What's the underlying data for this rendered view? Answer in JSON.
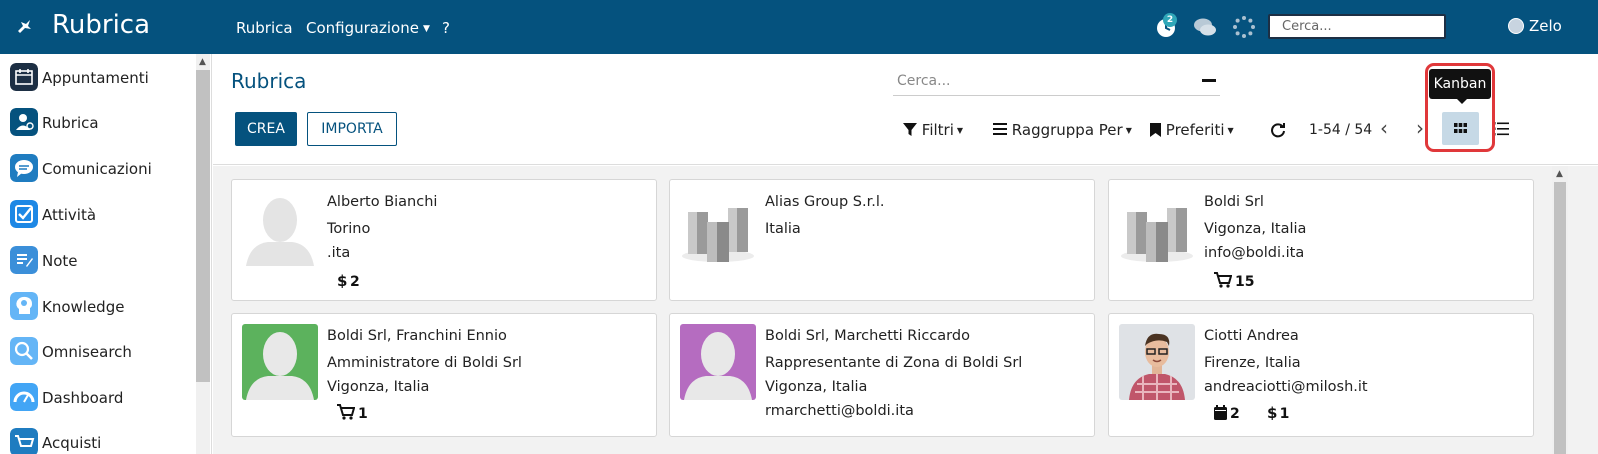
{
  "topbar": {
    "app_title": "Rubrica",
    "menu": [
      {
        "label": "Rubrica"
      },
      {
        "label": "Configurazione"
      },
      {
        "label": "?"
      }
    ],
    "activity_badge": "2",
    "search_placeholder": "Cerca...",
    "user_name": "Zelo",
    "color": "#05527e"
  },
  "sidebar": {
    "items": [
      {
        "label": "Appuntamenti",
        "icon": "calendar-icon",
        "color": "#1d2f44"
      },
      {
        "label": "Rubrica",
        "icon": "contacts-icon",
        "color": "#05527e"
      },
      {
        "label": "Comunicazioni",
        "icon": "chat-icon",
        "color": "#1f7cc0"
      },
      {
        "label": "Attività",
        "icon": "checkbox-icon",
        "color": "#1e88e5"
      },
      {
        "label": "Note",
        "icon": "note-icon",
        "color": "#3b8fd9"
      },
      {
        "label": "Knowledge",
        "icon": "brain-icon",
        "color": "#64b5f6"
      },
      {
        "label": "Omnisearch",
        "icon": "search-icon",
        "color": "#64b5f6"
      },
      {
        "label": "Dashboard",
        "icon": "dashboard-icon",
        "color": "#42a5f5"
      },
      {
        "label": "Acquisti",
        "icon": "cart-icon",
        "color": "#1f7cc0"
      }
    ]
  },
  "control_panel": {
    "title": "Rubrica",
    "search_placeholder": "Cerca...",
    "create_label": "CREA",
    "import_label": "IMPORTA",
    "filters_label": "Filtri",
    "group_by_label": "Raggruppa Per",
    "favorites_label": "Preferiti",
    "pager": "1-54 / 54",
    "tooltip": "Kanban",
    "active_view": "kanban"
  },
  "cards": [
    {
      "name": "Alberto Bianchi",
      "lines": [
        "Torino",
        ".ita"
      ],
      "image": "person-placeholder",
      "badges": [
        {
          "icon": "dollar-icon",
          "value": "2"
        }
      ]
    },
    {
      "name": "Alias Group S.r.l.",
      "lines": [
        "Italia"
      ],
      "image": "company-buildings",
      "badges": []
    },
    {
      "name": "Boldi Srl",
      "lines": [
        "Vigonza, Italia",
        "info@boldi.ita"
      ],
      "image": "company-buildings",
      "badges": [
        {
          "icon": "cart-icon",
          "value": "15"
        }
      ]
    },
    {
      "name": "Boldi Srl, Franchini Ennio",
      "lines": [
        "Amministratore di Boldi Srl",
        "Vigonza, Italia"
      ],
      "image": "person-green",
      "badges": [
        {
          "icon": "cart-icon",
          "value": "1"
        }
      ]
    },
    {
      "name": "Boldi Srl, Marchetti Riccardo",
      "lines": [
        "Rappresentante di Zona di Boldi Srl",
        "Vigonza, Italia",
        "rmarchetti@boldi.ita"
      ],
      "image": "person-purple",
      "badges": []
    },
    {
      "name": "Ciotti Andrea",
      "lines": [
        "Firenze, Italia",
        "andreaciotti@milosh.it"
      ],
      "image": "person-photo",
      "badges": [
        {
          "icon": "calendar-icon",
          "value": "2"
        },
        {
          "icon": "dollar-icon",
          "value": "1"
        }
      ]
    }
  ]
}
